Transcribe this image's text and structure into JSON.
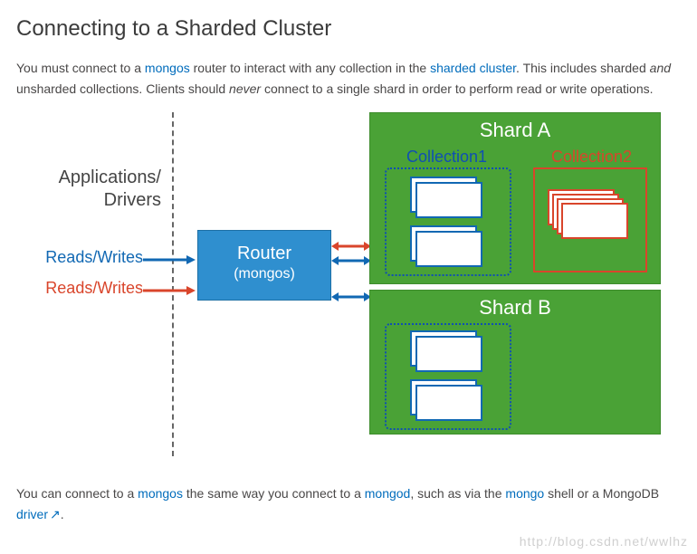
{
  "title": "Connecting to a Sharded Cluster",
  "intro": {
    "t1": "You must connect to a ",
    "link1": "mongos",
    "t2": " router to interact with any collection in the ",
    "link2": "sharded cluster",
    "t3": ". This includes sharded ",
    "em1": "and",
    "t4": " unsharded collections. Clients should ",
    "em2": "never",
    "t5": " connect to a single shard in order to perform read or write operations."
  },
  "diagram": {
    "apps_line1": "Applications/",
    "apps_line2": "Drivers",
    "rw_blue": "Reads/Writes",
    "rw_red": "Reads/Writes",
    "router_title": "Router",
    "router_sub": "(mongos)",
    "shard_a": "Shard A",
    "shard_b": "Shard B",
    "coll1": "Collection1",
    "coll2": "Collection2"
  },
  "outro": {
    "t1": "You can connect to a ",
    "link1": "mongos",
    "t2": " the same way you connect to a ",
    "link2": "mongod",
    "t3": ", such as via the ",
    "link3": "mongo",
    "t4": " shell or a MongoDB ",
    "link4": "driver",
    "ext_icon": "↗",
    "t5": "."
  },
  "watermark": "http://blog.csdn.net/wwlhz"
}
